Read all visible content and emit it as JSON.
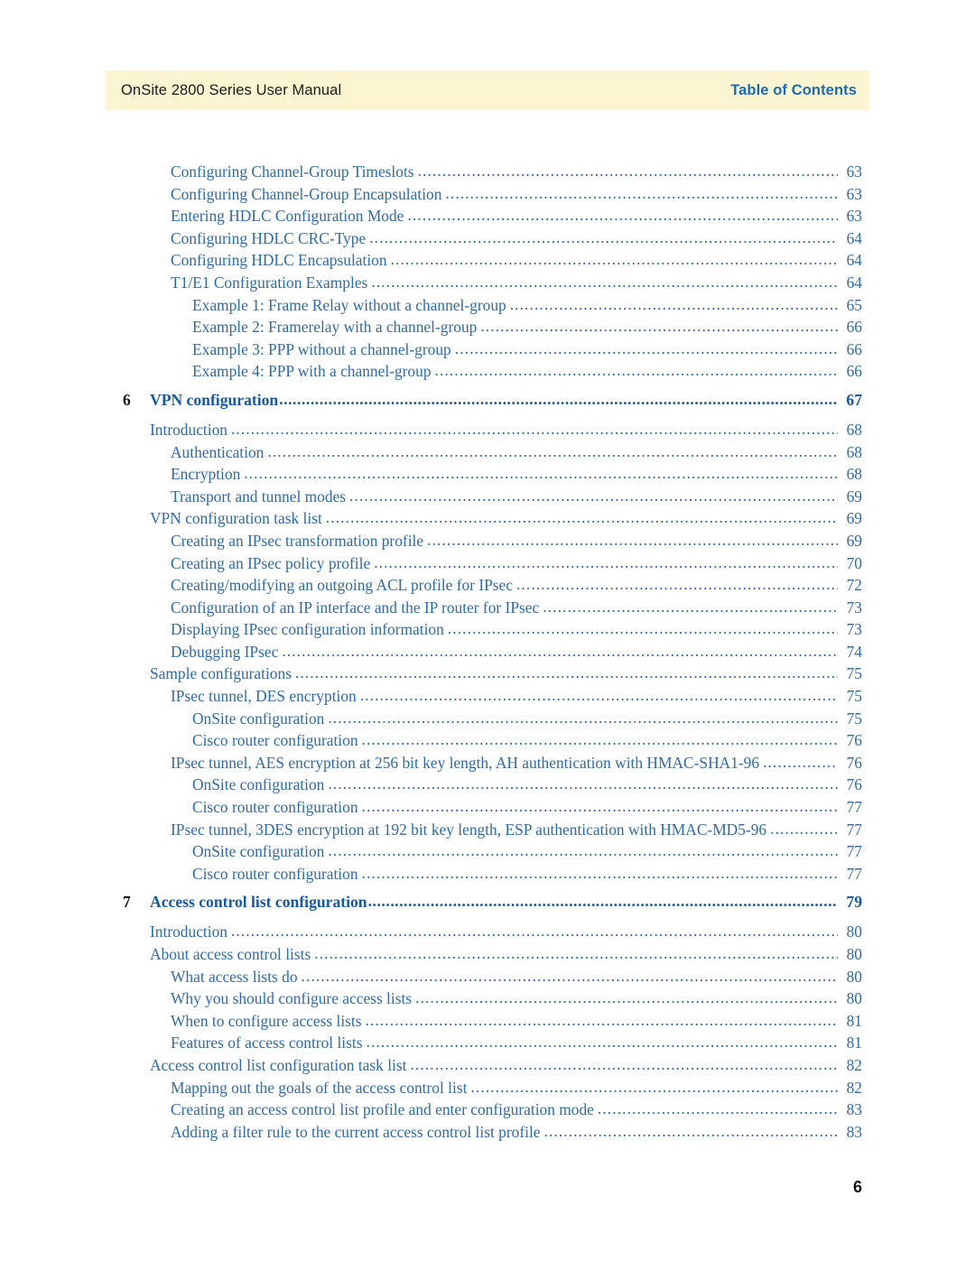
{
  "header": {
    "manual_title": "OnSite 2800 Series User Manual",
    "section_label": "Table of Contents",
    "band_color": "#fbf6d1",
    "section_color": "#1a6bb5"
  },
  "colors": {
    "entry_blue": "#2f6ba6",
    "chapter_blue": "#15599e",
    "chapter_number": "#16181a",
    "page_background": "#ffffff"
  },
  "footer": {
    "page_number": "6"
  },
  "toc": {
    "entries": [
      {
        "level": 2,
        "label": "Configuring Channel-Group Timeslots",
        "page": "63",
        "type": "entry"
      },
      {
        "level": 2,
        "label": "Configuring Channel-Group Encapsulation",
        "page": "63",
        "type": "entry"
      },
      {
        "level": 2,
        "label": "Entering HDLC Configuration Mode",
        "page": "63",
        "type": "entry"
      },
      {
        "level": 2,
        "label": "Configuring HDLC CRC-Type",
        "page": "64",
        "type": "entry"
      },
      {
        "level": 2,
        "label": "Configuring HDLC Encapsulation",
        "page": "64",
        "type": "entry"
      },
      {
        "level": 2,
        "label": "T1/E1 Configuration Examples",
        "page": "64",
        "type": "entry"
      },
      {
        "level": 3,
        "label": "Example 1: Frame Relay without a channel-group",
        "page": "65",
        "type": "entry"
      },
      {
        "level": 3,
        "label": "Example 2: Framerelay with a channel-group",
        "page": "66",
        "type": "entry"
      },
      {
        "level": 3,
        "label": "Example 3: PPP without a channel-group",
        "page": "66",
        "type": "entry"
      },
      {
        "level": 3,
        "label": "Example 4: PPP with a channel-group",
        "page": "66",
        "type": "entry"
      },
      {
        "level": 0,
        "number": "6",
        "label": "VPN configuration",
        "page": "67",
        "type": "chapter"
      },
      {
        "level": 1,
        "label": "Introduction",
        "page": "68",
        "type": "entry"
      },
      {
        "level": 2,
        "label": "Authentication",
        "page": "68",
        "type": "entry"
      },
      {
        "level": 2,
        "label": "Encryption",
        "page": "68",
        "type": "entry"
      },
      {
        "level": 2,
        "label": "Transport and tunnel modes",
        "page": "69",
        "type": "entry"
      },
      {
        "level": 1,
        "label": "VPN configuration task list",
        "page": "69",
        "type": "entry"
      },
      {
        "level": 2,
        "label": "Creating an IPsec transformation profile",
        "page": "69",
        "type": "entry"
      },
      {
        "level": 2,
        "label": "Creating an IPsec policy profile",
        "page": "70",
        "type": "entry"
      },
      {
        "level": 2,
        "label": "Creating/modifying an outgoing ACL profile for IPsec",
        "page": "72",
        "type": "entry"
      },
      {
        "level": 2,
        "label": "Configuration of an IP interface and the IP router for IPsec",
        "page": "73",
        "type": "entry"
      },
      {
        "level": 2,
        "label": "Displaying IPsec configuration information",
        "page": "73",
        "type": "entry"
      },
      {
        "level": 2,
        "label": "Debugging IPsec",
        "page": "74",
        "type": "entry"
      },
      {
        "level": 1,
        "label": "Sample configurations",
        "page": "75",
        "type": "entry"
      },
      {
        "level": 2,
        "label": "IPsec tunnel, DES encryption",
        "page": "75",
        "type": "entry"
      },
      {
        "level": 3,
        "label": "OnSite configuration",
        "page": "75",
        "type": "entry"
      },
      {
        "level": 3,
        "label": "Cisco router configuration",
        "page": "76",
        "type": "entry"
      },
      {
        "level": 2,
        "label": "IPsec tunnel, AES encryption at 256 bit key length, AH authentication with HMAC-SHA1-96",
        "page": "76",
        "type": "entry"
      },
      {
        "level": 3,
        "label": "OnSite configuration",
        "page": "76",
        "type": "entry"
      },
      {
        "level": 3,
        "label": "Cisco router configuration",
        "page": "77",
        "type": "entry"
      },
      {
        "level": 2,
        "label": "IPsec tunnel, 3DES encryption at 192 bit key length, ESP authentication with HMAC-MD5-96",
        "page": "77",
        "type": "entry"
      },
      {
        "level": 3,
        "label": "OnSite configuration",
        "page": "77",
        "type": "entry"
      },
      {
        "level": 3,
        "label": "Cisco router configuration",
        "page": "77",
        "type": "entry"
      },
      {
        "level": 0,
        "number": "7",
        "label": "Access control list configuration",
        "page": "79",
        "type": "chapter"
      },
      {
        "level": 1,
        "label": "Introduction",
        "page": "80",
        "type": "entry"
      },
      {
        "level": 1,
        "label": "About access control lists",
        "page": "80",
        "type": "entry"
      },
      {
        "level": 2,
        "label": "What access lists do",
        "page": "80",
        "type": "entry"
      },
      {
        "level": 2,
        "label": "Why you should configure access lists",
        "page": "80",
        "type": "entry"
      },
      {
        "level": 2,
        "label": "When to configure access lists",
        "page": "81",
        "type": "entry"
      },
      {
        "level": 2,
        "label": "Features of access control lists",
        "page": "81",
        "type": "entry"
      },
      {
        "level": 1,
        "label": "Access control list configuration task list",
        "page": "82",
        "type": "entry"
      },
      {
        "level": 2,
        "label": "Mapping out the goals of the access control list",
        "page": "82",
        "type": "entry"
      },
      {
        "level": 2,
        "label": "Creating an access control list profile and enter configuration mode",
        "page": "83",
        "type": "entry"
      },
      {
        "level": 2,
        "label": "Adding a filter rule to the current access control list profile",
        "page": "83",
        "type": "entry"
      }
    ]
  }
}
